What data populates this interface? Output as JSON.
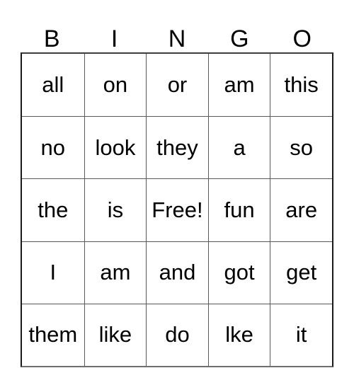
{
  "card": {
    "title": "BINGO",
    "free_space_label": "Free!",
    "free_space_position": {
      "row": 2,
      "col": 2
    },
    "grid_size": {
      "rows": 5,
      "cols": 5
    },
    "colors": {
      "background": "#ffffff",
      "text": "#000000",
      "border_outer": "#1a1a1a",
      "border_inner": "#5a5a5a"
    },
    "headers": [
      {
        "letter": "B"
      },
      {
        "letter": "I"
      },
      {
        "letter": "N"
      },
      {
        "letter": "G"
      },
      {
        "letter": "O"
      }
    ],
    "rows": [
      {
        "cells": [
          {
            "word": "all"
          },
          {
            "word": "on"
          },
          {
            "word": "or"
          },
          {
            "word": "am"
          },
          {
            "word": "this"
          }
        ]
      },
      {
        "cells": [
          {
            "word": "no"
          },
          {
            "word": "look"
          },
          {
            "word": "they"
          },
          {
            "word": "a"
          },
          {
            "word": "so"
          }
        ]
      },
      {
        "cells": [
          {
            "word": "the"
          },
          {
            "word": "is"
          },
          {
            "word": "Free!"
          },
          {
            "word": "fun"
          },
          {
            "word": "are"
          }
        ]
      },
      {
        "cells": [
          {
            "word": "I"
          },
          {
            "word": "am"
          },
          {
            "word": "and"
          },
          {
            "word": "got"
          },
          {
            "word": "get"
          }
        ]
      },
      {
        "cells": [
          {
            "word": "them"
          },
          {
            "word": "like"
          },
          {
            "word": "do"
          },
          {
            "word": "lke"
          },
          {
            "word": "it"
          }
        ]
      }
    ]
  }
}
